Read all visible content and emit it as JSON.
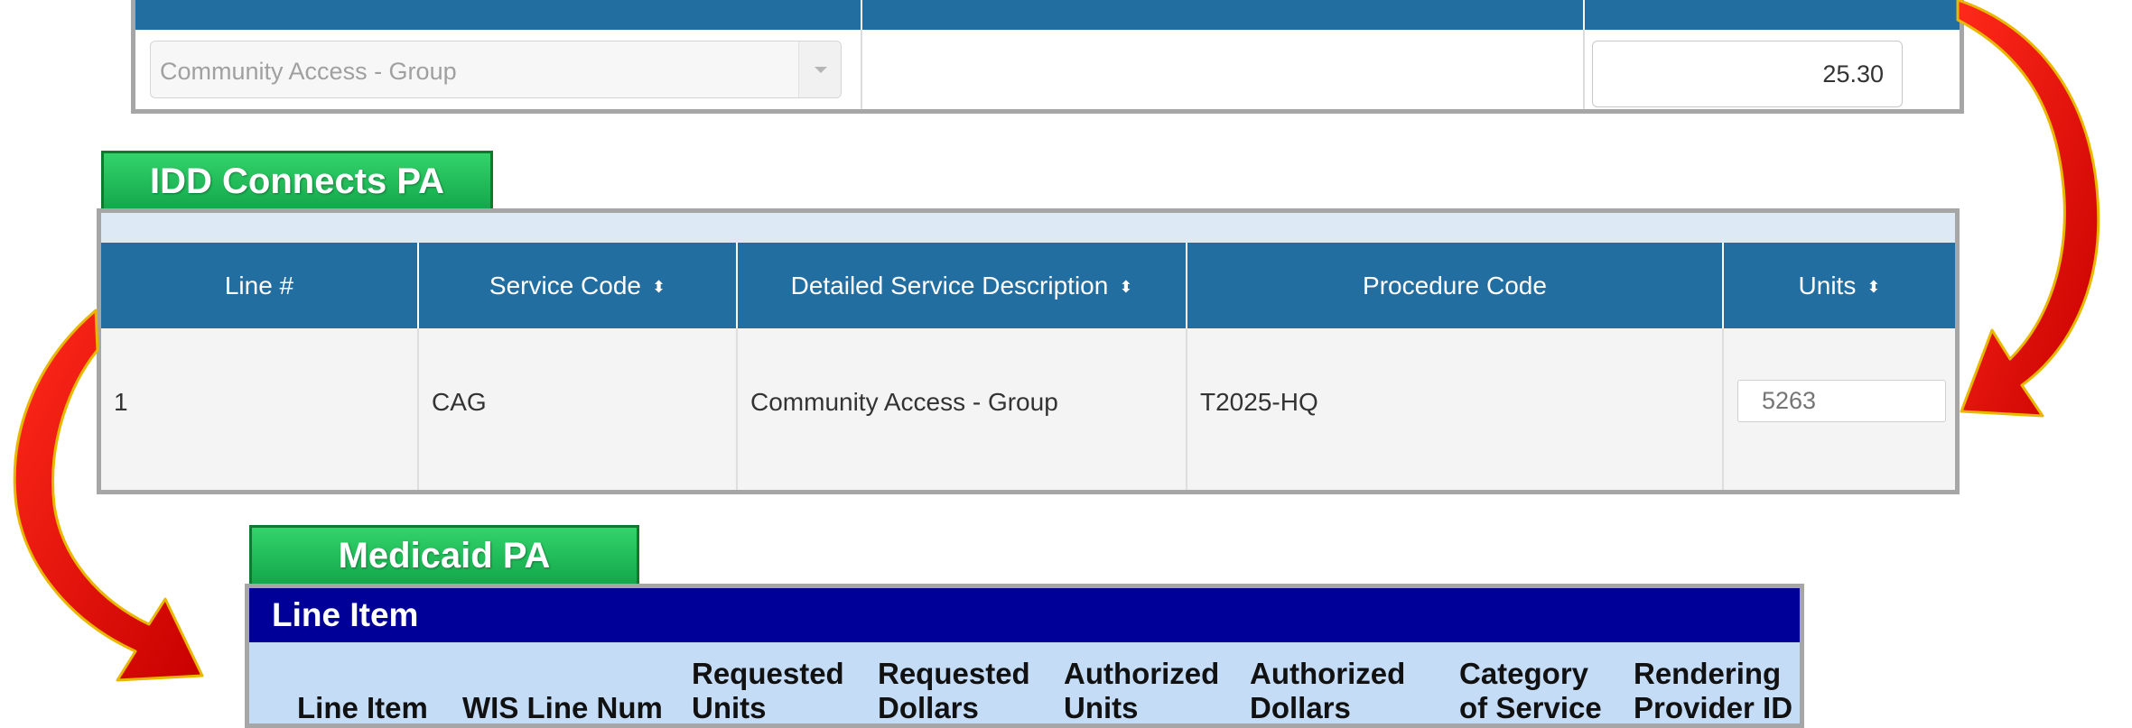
{
  "top_panel": {
    "service_select_value": "Community Access - Group",
    "rate_value": "25.30"
  },
  "idd_panel": {
    "label": "IDD Connects PA",
    "columns": [
      {
        "label": "Line #",
        "sortable": false
      },
      {
        "label": "Service Code",
        "sortable": true
      },
      {
        "label": "Detailed Service Description",
        "sortable": true
      },
      {
        "label": "Procedure Code",
        "sortable": false
      },
      {
        "label": "Units",
        "sortable": true
      }
    ],
    "sort_icon": "⬍",
    "row": {
      "line_num": "1",
      "service_code": "CAG",
      "description": "Community Access - Group",
      "procedure_code": "T2025-HQ",
      "units_placeholder": "5263"
    }
  },
  "medicaid_panel": {
    "label": "Medicaid PA",
    "title": "Line Item",
    "columns": [
      {
        "line1": "",
        "line2": "Line Item"
      },
      {
        "line1": "",
        "line2": "WIS Line Num"
      },
      {
        "line1": "Requested",
        "line2": "Units"
      },
      {
        "line1": "Requested",
        "line2": "Dollars"
      },
      {
        "line1": "Authorized",
        "line2": "Units"
      },
      {
        "line1": "Authorized",
        "line2": "Dollars"
      },
      {
        "line1": "Category",
        "line2": "of Service"
      },
      {
        "line1": "Rendering",
        "line2": "Provider ID"
      }
    ]
  },
  "colors": {
    "table_header": "#236ea1",
    "green_tab": "#1bbf57",
    "medicaid_title": "#000099",
    "medicaid_col_bar": "#c5dcf7",
    "arrow_red": "#ee1111",
    "arrow_outline": "#e8b800"
  }
}
